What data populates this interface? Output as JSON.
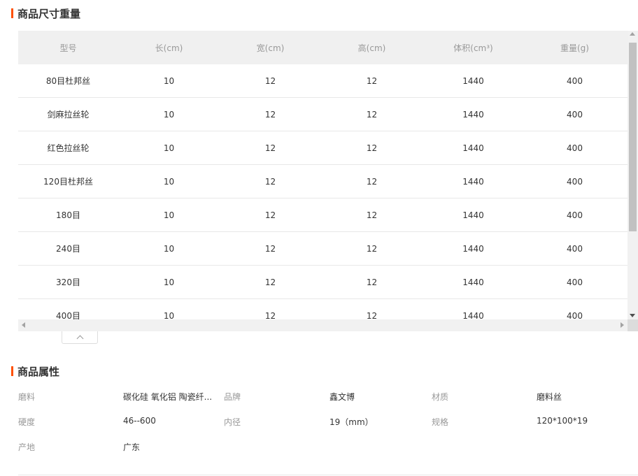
{
  "size_section": {
    "title": "商品尺寸重量"
  },
  "size_table": {
    "columns": [
      "型号",
      "长(cm)",
      "宽(cm)",
      "高(cm)",
      "体积(cm³)",
      "重量(g)"
    ],
    "rows": [
      [
        "80目杜邦丝",
        "10",
        "12",
        "12",
        "1440",
        "400"
      ],
      [
        "剑麻拉丝轮",
        "10",
        "12",
        "12",
        "1440",
        "400"
      ],
      [
        "红色拉丝轮",
        "10",
        "12",
        "12",
        "1440",
        "400"
      ],
      [
        "120目杜邦丝",
        "10",
        "12",
        "12",
        "1440",
        "400"
      ],
      [
        "180目",
        "10",
        "12",
        "12",
        "1440",
        "400"
      ],
      [
        "240目",
        "10",
        "12",
        "12",
        "1440",
        "400"
      ],
      [
        "320目",
        "10",
        "12",
        "12",
        "1440",
        "400"
      ],
      [
        "400目",
        "10",
        "12",
        "12",
        "1440",
        "400"
      ]
    ]
  },
  "attr_section": {
    "title": "商品属性"
  },
  "attributes": [
    {
      "key": "磨料",
      "value": "碳化硅 氧化铝 陶瓷纤..."
    },
    {
      "key": "品牌",
      "value": "鑫文博"
    },
    {
      "key": "材质",
      "value": "磨料丝"
    },
    {
      "key": "硬度",
      "value": "46--600"
    },
    {
      "key": "内径",
      "value": "19（mm）"
    },
    {
      "key": "规格",
      "value": "120*100*19"
    },
    {
      "key": "产地",
      "value": "广东"
    }
  ],
  "colors": {
    "accent": "#ff5000",
    "header_bg": "#f0f0f0",
    "muted_text": "#999999"
  },
  "icons": {
    "collapse": "chevron-up-icon"
  }
}
